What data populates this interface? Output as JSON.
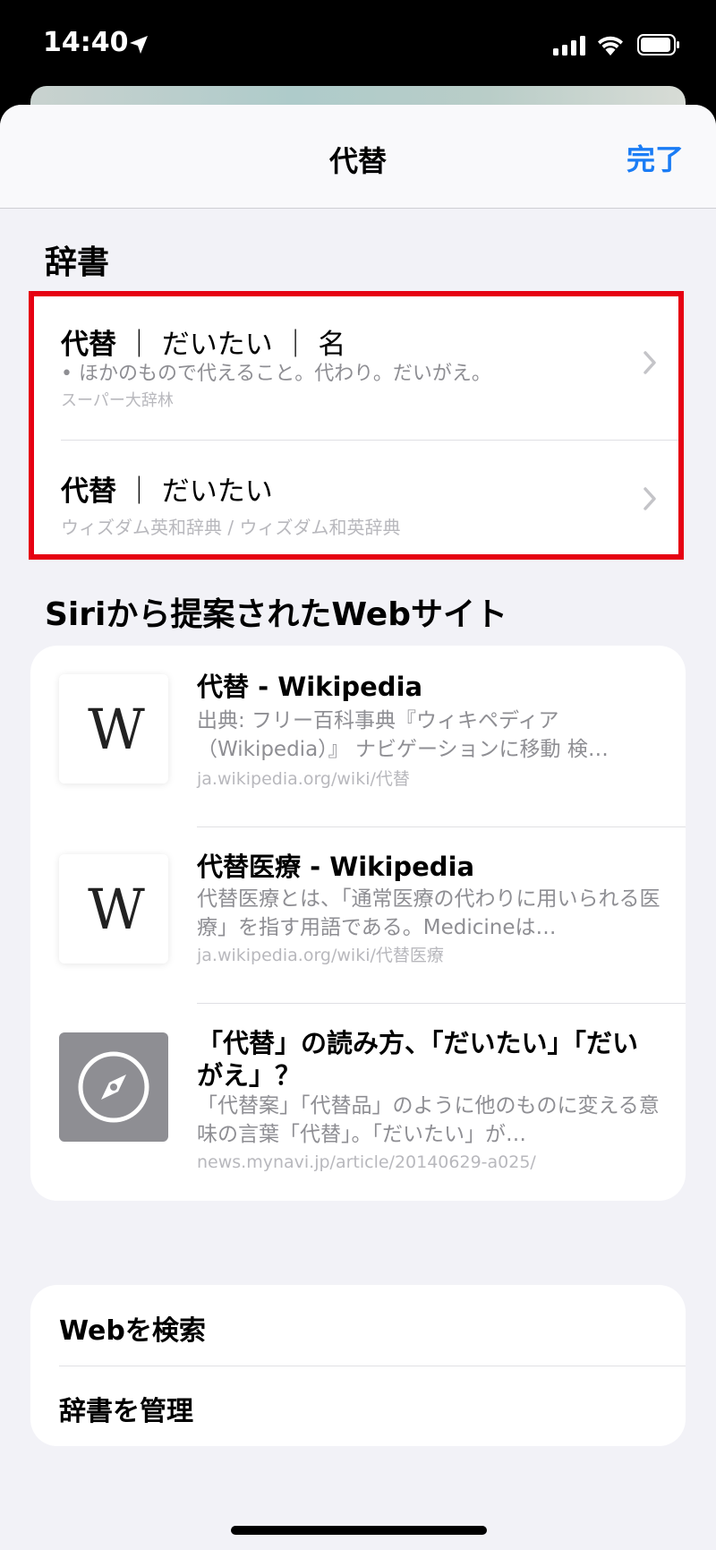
{
  "status_bar": {
    "time": "14:40",
    "icons": [
      "location-arrow-icon",
      "cellular-signal-icon",
      "wifi-icon",
      "battery-icon"
    ]
  },
  "nav": {
    "title": "代替",
    "done_label": "完了"
  },
  "dictionary": {
    "header": "辞書",
    "entries": [
      {
        "title_word": "代替",
        "title_rest": "｜ だいたい ｜ 名",
        "definition": "• ほかのもので代えること。代わり。だいがえ。",
        "source": "スーパー大辞林"
      },
      {
        "title_word": "代替",
        "title_rest": "｜ だいたい",
        "definition": "",
        "source": "ウィズダム英和辞典 / ウィズダム和英辞典"
      }
    ]
  },
  "siri": {
    "header": "Siriから提案されたWebサイト",
    "results": [
      {
        "thumb": "wikipedia-logo-icon",
        "thumb_text": "W",
        "title": "代替 - Wikipedia",
        "desc": "出典: フリー百科事典『ウィキペディア（Wikipedia）』 ナビゲーションに移動 検…",
        "url": "ja.wikipedia.org/wiki/代替"
      },
      {
        "thumb": "wikipedia-logo-icon",
        "thumb_text": "W",
        "title": "代替医療 - Wikipedia",
        "desc": "代替医療とは、「通常医療の代わりに用いられる医療」を指す用語である。Medicineは…",
        "url": "ja.wikipedia.org/wiki/代替医療"
      },
      {
        "thumb": "safari-compass-icon",
        "thumb_text": "",
        "title": "「代替」の読み方、「だいたい」「だいがえ」？",
        "desc": "「代替案」「代替品」のように他のものに変える意味の言葉「代替」。「だいたい」が…",
        "url": "news.mynavi.jp/article/20140629-a025/"
      }
    ]
  },
  "actions": {
    "search_web": "Webを検索",
    "manage_dictionaries": "辞書を管理"
  },
  "colors": {
    "accent": "#1a7cf5",
    "highlight_border": "#e60012",
    "background": "#f2f2f7"
  }
}
